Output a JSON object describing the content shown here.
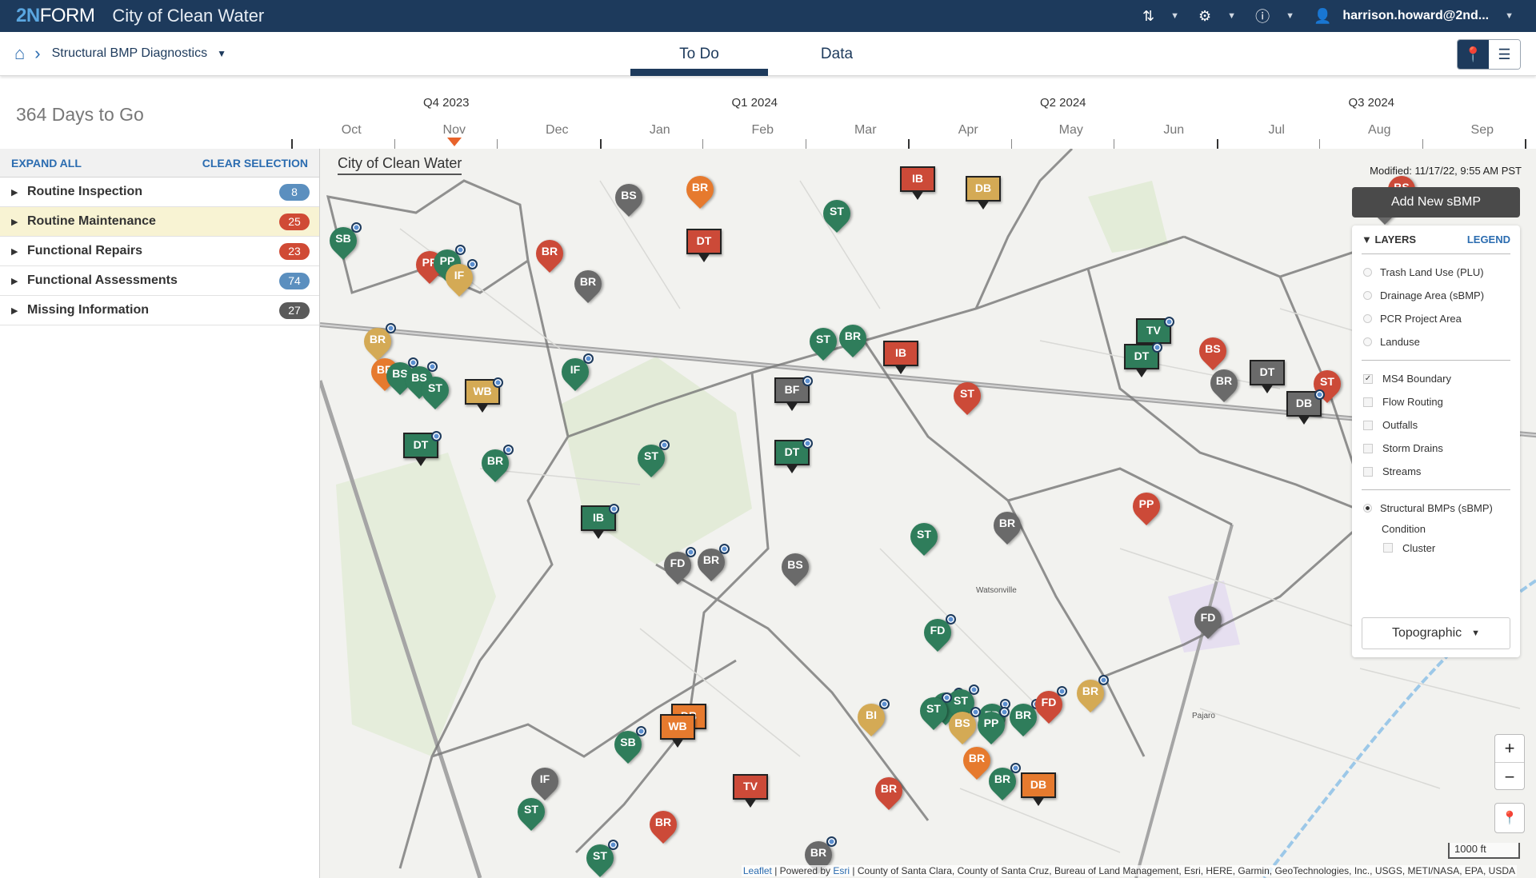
{
  "topbar": {
    "logo_prefix": "2N",
    "logo_suffix": "FORM",
    "app_title": "City of Clean Water",
    "user": "harrison.howard@2nd...",
    "icons": [
      "sort-icon",
      "gear-icon",
      "help-icon",
      "user-icon"
    ]
  },
  "breadcrumb": {
    "current": "Structural BMP Diagnostics"
  },
  "tabs": [
    {
      "label": "To Do",
      "active": true
    },
    {
      "label": "Data",
      "active": false
    }
  ],
  "timeline": {
    "days_to_go": "364 Days to Go",
    "quarters": [
      "Q4 2023",
      "Q1 2024",
      "Q2 2024",
      "Q3 2024"
    ],
    "months": [
      "Oct",
      "Nov",
      "Dec",
      "Jan",
      "Feb",
      "Mar",
      "Apr",
      "May",
      "Jun",
      "Jul",
      "Aug",
      "Sep"
    ],
    "current_month_index": 1,
    "marker_color": "#e8632b"
  },
  "sidebar": {
    "expand_all": "EXPAND ALL",
    "clear_selection": "CLEAR SELECTION",
    "items": [
      {
        "label": "Routine Inspection",
        "count": "8",
        "color": "#5b8fbf",
        "highlighted": false
      },
      {
        "label": "Routine Maintenance",
        "count": "25",
        "color": "#d04a35",
        "highlighted": true
      },
      {
        "label": "Functional Repairs",
        "count": "23",
        "color": "#d04a35",
        "highlighted": false
      },
      {
        "label": "Functional Assessments",
        "count": "74",
        "color": "#5b8fbf",
        "highlighted": false
      },
      {
        "label": "Missing Information",
        "count": "27",
        "color": "#5a5a5a",
        "highlighted": false
      }
    ]
  },
  "map": {
    "title": "City of Clean Water",
    "modified": "Modified: 11/17/22, 9:55 AM PST",
    "add_button": "Add New sBMP",
    "colors": {
      "green": "#2f7d5b",
      "red": "#cc4a38",
      "gray": "#6a6a6a",
      "orange": "#e67a2e",
      "tan": "#d4aa55"
    },
    "markers": [
      {
        "code": "SB",
        "color": "green",
        "shape": "pin",
        "dot": true
      },
      {
        "code": "PP",
        "color": "red",
        "shape": "pin",
        "dot": false
      },
      {
        "code": "PP",
        "color": "green",
        "shape": "pin",
        "dot": true
      },
      {
        "code": "IF",
        "color": "tan",
        "shape": "pin",
        "dot": true
      },
      {
        "code": "BS",
        "color": "gray",
        "shape": "pin",
        "dot": false
      },
      {
        "code": "BR",
        "color": "orange",
        "shape": "pin",
        "dot": false
      },
      {
        "code": "BR",
        "color": "red",
        "shape": "pin",
        "dot": false
      },
      {
        "code": "BR",
        "color": "gray",
        "shape": "pin",
        "dot": false
      },
      {
        "code": "DT",
        "color": "red",
        "shape": "box",
        "dot": false
      },
      {
        "code": "ST",
        "color": "green",
        "shape": "pin",
        "dot": false
      },
      {
        "code": "BR",
        "color": "tan",
        "shape": "pin",
        "dot": true
      },
      {
        "code": "BR",
        "color": "orange",
        "shape": "pin",
        "dot": false
      },
      {
        "code": "BS",
        "color": "green",
        "shape": "pin",
        "dot": true
      },
      {
        "code": "BS",
        "color": "green",
        "shape": "pin",
        "dot": true
      },
      {
        "code": "ST",
        "color": "green",
        "shape": "pin",
        "dot": false
      },
      {
        "code": "WB",
        "color": "tan",
        "shape": "box",
        "dot": true
      },
      {
        "code": "IF",
        "color": "green",
        "shape": "pin",
        "dot": true
      },
      {
        "code": "DT",
        "color": "green",
        "shape": "box",
        "dot": true
      },
      {
        "code": "BR",
        "color": "green",
        "shape": "pin",
        "dot": true
      },
      {
        "code": "ST",
        "color": "green",
        "shape": "pin",
        "dot": true
      },
      {
        "code": "DT",
        "color": "green",
        "shape": "box",
        "dot": true
      },
      {
        "code": "ST",
        "color": "green",
        "shape": "pin",
        "dot": false
      },
      {
        "code": "BF",
        "color": "gray",
        "shape": "box",
        "dot": true
      },
      {
        "code": "BR",
        "color": "green",
        "shape": "pin",
        "dot": false
      },
      {
        "code": "IB",
        "color": "red",
        "shape": "box",
        "dot": false
      },
      {
        "code": "IB",
        "color": "red",
        "shape": "box",
        "dot": false
      },
      {
        "code": "DB",
        "color": "tan",
        "shape": "box",
        "dot": false
      },
      {
        "code": "TV",
        "color": "green",
        "shape": "box",
        "dot": true
      },
      {
        "code": "DT",
        "color": "green",
        "shape": "box",
        "dot": true
      },
      {
        "code": "BS",
        "color": "red",
        "shape": "pin",
        "dot": false
      },
      {
        "code": "BR",
        "color": "gray",
        "shape": "pin",
        "dot": false
      },
      {
        "code": "DT",
        "color": "gray",
        "shape": "box",
        "dot": false
      },
      {
        "code": "ST",
        "color": "red",
        "shape": "pin",
        "dot": false
      },
      {
        "code": "DB",
        "color": "gray",
        "shape": "box",
        "dot": true
      },
      {
        "code": "BS",
        "color": "red",
        "shape": "pin",
        "dot": false
      },
      {
        "code": "IF",
        "color": "gray",
        "shape": "pin",
        "dot": false
      },
      {
        "code": "ST",
        "color": "red",
        "shape": "pin",
        "dot": false
      },
      {
        "code": "ST",
        "color": "red",
        "shape": "pin",
        "dot": false
      },
      {
        "code": "ST",
        "color": "red",
        "shape": "pin",
        "dot": false
      },
      {
        "code": "IB",
        "color": "green",
        "shape": "box",
        "dot": true
      },
      {
        "code": "FD",
        "color": "gray",
        "shape": "pin",
        "dot": true
      },
      {
        "code": "BR",
        "color": "gray",
        "shape": "pin",
        "dot": true
      },
      {
        "code": "BS",
        "color": "gray",
        "shape": "pin",
        "dot": false
      },
      {
        "code": "ST",
        "color": "green",
        "shape": "pin",
        "dot": false
      },
      {
        "code": "BR",
        "color": "gray",
        "shape": "pin",
        "dot": false
      },
      {
        "code": "PP",
        "color": "red",
        "shape": "pin",
        "dot": false
      },
      {
        "code": "FD",
        "color": "gray",
        "shape": "pin",
        "dot": false
      },
      {
        "code": "FD",
        "color": "green",
        "shape": "pin",
        "dot": true
      },
      {
        "code": "DB",
        "color": "orange",
        "shape": "box",
        "dot": false
      },
      {
        "code": "WB",
        "color": "orange",
        "shape": "box",
        "dot": false
      },
      {
        "code": "SB",
        "color": "green",
        "shape": "pin",
        "dot": true
      },
      {
        "code": "BI",
        "color": "tan",
        "shape": "pin",
        "dot": true
      },
      {
        "code": "FD",
        "color": "green",
        "shape": "pin",
        "dot": true
      },
      {
        "code": "ST",
        "color": "green",
        "shape": "pin",
        "dot": true
      },
      {
        "code": "ST",
        "color": "green",
        "shape": "pin",
        "dot": true
      },
      {
        "code": "ST",
        "color": "green",
        "shape": "pin",
        "dot": true
      },
      {
        "code": "BS",
        "color": "tan",
        "shape": "pin",
        "dot": true
      },
      {
        "code": "PP",
        "color": "green",
        "shape": "pin",
        "dot": true
      },
      {
        "code": "BR",
        "color": "green",
        "shape": "pin",
        "dot": true
      },
      {
        "code": "FD",
        "color": "red",
        "shape": "pin",
        "dot": true
      },
      {
        "code": "BR",
        "color": "tan",
        "shape": "pin",
        "dot": true
      },
      {
        "code": "BR",
        "color": "orange",
        "shape": "pin",
        "dot": false
      },
      {
        "code": "BR",
        "color": "green",
        "shape": "pin",
        "dot": true
      },
      {
        "code": "DB",
        "color": "orange",
        "shape": "box",
        "dot": false
      },
      {
        "code": "BR",
        "color": "red",
        "shape": "pin",
        "dot": false
      },
      {
        "code": "IF",
        "color": "gray",
        "shape": "pin",
        "dot": false
      },
      {
        "code": "TV",
        "color": "red",
        "shape": "box",
        "dot": false
      },
      {
        "code": "ST",
        "color": "green",
        "shape": "pin",
        "dot": false
      },
      {
        "code": "BR",
        "color": "red",
        "shape": "pin",
        "dot": false
      },
      {
        "code": "ST",
        "color": "green",
        "shape": "pin",
        "dot": true
      },
      {
        "code": "BR",
        "color": "gray",
        "shape": "pin",
        "dot": true
      }
    ],
    "place_labels": [
      "Watsonville",
      "Pajaro"
    ]
  },
  "layers": {
    "header": "LAYERS",
    "legend": "LEGEND",
    "basemap_layers": [
      {
        "label": "Trash Land Use (PLU)",
        "selected": false
      },
      {
        "label": "Drainage Area (sBMP)",
        "selected": false
      },
      {
        "label": "PCR Project Area",
        "selected": false
      },
      {
        "label": "Landuse",
        "selected": false
      }
    ],
    "overlays": [
      {
        "label": "MS4 Boundary",
        "checked": true
      },
      {
        "label": "Flow Routing",
        "checked": false
      },
      {
        "label": "Outfalls",
        "checked": false
      },
      {
        "label": "Storm Drains",
        "checked": false
      },
      {
        "label": "Streams",
        "checked": false
      }
    ],
    "sbmp": {
      "label": "Structural BMPs (sBMP)",
      "selected": true,
      "sub_label": "Condition",
      "cluster_label": "Cluster",
      "cluster_checked": false
    },
    "basemap": "Topographic"
  },
  "controls": {
    "zoom_in": "+",
    "zoom_out": "−",
    "scale": "1000 ft"
  },
  "attribution": {
    "leaflet": "Leaflet",
    "powered": " | Powered by ",
    "esri": "Esri",
    "sources": " | County of Santa Clara, County of Santa Cruz, Bureau of Land Management, Esri, HERE, Garmin, GeoTechnologies, Inc., USGS, METI/NASA, EPA, USDA"
  }
}
